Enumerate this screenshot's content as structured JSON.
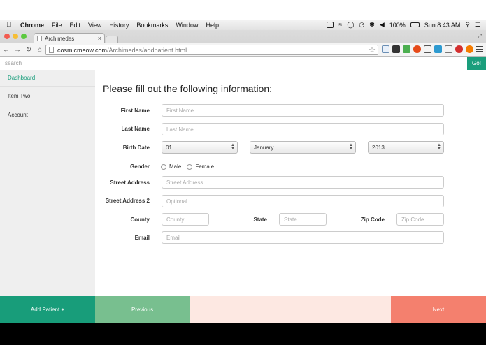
{
  "menubar": {
    "app": "Chrome",
    "items": [
      "File",
      "Edit",
      "View",
      "History",
      "Bookmarks",
      "Window",
      "Help"
    ],
    "battery": "100%",
    "clock": "Sun 8:43 AM"
  },
  "browser": {
    "tab_title": "Archimedes",
    "tab_close": "×",
    "url_host": "cosmicmeow.com",
    "url_path": "/Archimedes/addpatient.html"
  },
  "search": {
    "placeholder": "search",
    "go_label": "Go!"
  },
  "sidebar": {
    "items": [
      {
        "label": "Dashboard"
      },
      {
        "label": "Item Two"
      },
      {
        "label": "Account"
      }
    ]
  },
  "form": {
    "title": "Please fill out the following information:",
    "first_name": {
      "label": "First Name",
      "placeholder": "First Name"
    },
    "last_name": {
      "label": "Last Name",
      "placeholder": "Last Name"
    },
    "birth_date": {
      "label": "Birth Date",
      "day": "01",
      "month": "January",
      "year": "2013"
    },
    "gender": {
      "label": "Gender",
      "options": [
        "Male",
        "Female"
      ]
    },
    "street": {
      "label": "Street Address",
      "placeholder": "Street Address"
    },
    "street2": {
      "label": "Street Address 2",
      "placeholder": "Optional"
    },
    "county": {
      "label": "County",
      "placeholder": "County"
    },
    "state": {
      "label": "State",
      "placeholder": "State"
    },
    "zip": {
      "label": "Zip Code",
      "placeholder": "Zip Code"
    },
    "email": {
      "label": "Email",
      "placeholder": "Email"
    }
  },
  "footer": {
    "add_label": "Add Patient +",
    "prev_label": "Previous",
    "next_label": "Next"
  },
  "colors": {
    "accent": "#1a9e7c",
    "previous": "#78bf8f",
    "next": "#f4806e",
    "spacer": "#fde8e2"
  }
}
